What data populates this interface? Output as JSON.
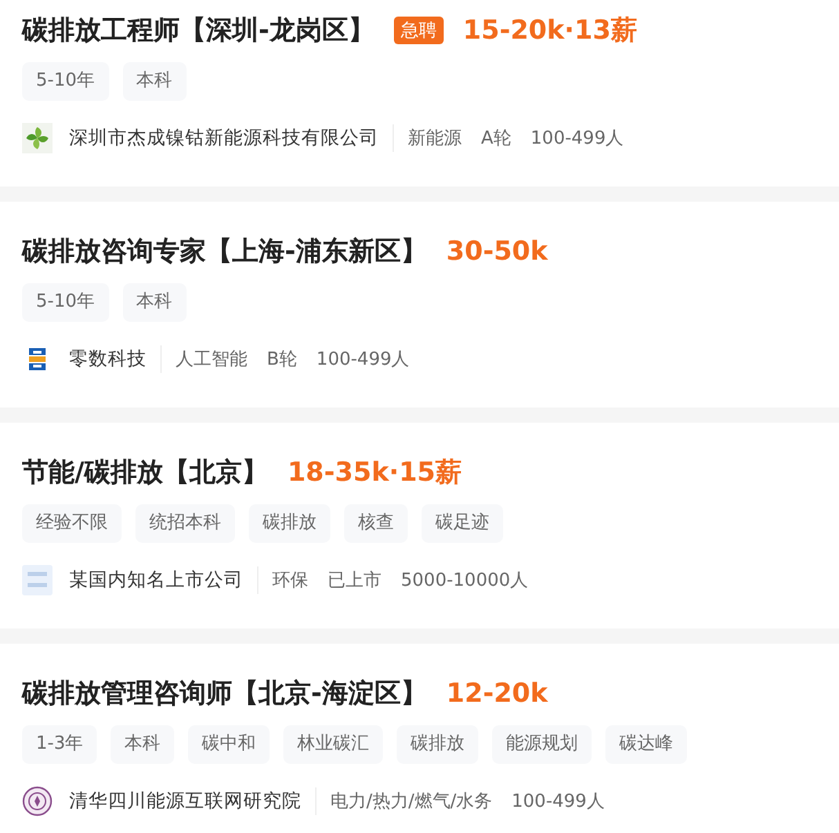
{
  "jobs": [
    {
      "title": "碳排放工程师【深圳-龙岗区】",
      "urgent_badge": "急聘",
      "salary": "15-20k·13薪",
      "tags": [
        "5-10年",
        "本科"
      ],
      "company": {
        "logo": {
          "kind": "leaf"
        },
        "name": "深圳市杰成镍钴新能源科技有限公司",
        "details": [
          "新能源",
          "A轮",
          "100-499人"
        ]
      }
    },
    {
      "title": "碳排放咨询专家【上海-浦东新区】",
      "salary": "30-50k",
      "tags": [
        "5-10年",
        "本科"
      ],
      "company": {
        "logo": {
          "kind": "blocks"
        },
        "name": "零数科技",
        "details": [
          "人工智能",
          "B轮",
          "100-499人"
        ]
      }
    },
    {
      "title": "节能/碳排放【北京】",
      "salary": "18-35k·15薪",
      "tags": [
        "经验不限",
        "统招本科",
        "碳排放",
        "核查",
        "碳足迹"
      ],
      "company": {
        "logo": {
          "kind": "placeholder"
        },
        "name": "某国内知名上市公司",
        "details": [
          "环保",
          "已上市",
          "5000-10000人"
        ]
      }
    },
    {
      "title": "碳排放管理咨询师【北京-海淀区】",
      "salary": "12-20k",
      "tags": [
        "1-3年",
        "本科",
        "碳中和",
        "林业碳汇",
        "碳排放",
        "能源规划",
        "碳达峰"
      ],
      "company": {
        "logo": {
          "kind": "seal"
        },
        "name": "清华四川能源互联网研究院",
        "details": [
          "电力/热力/燃气/水务",
          "100-499人"
        ]
      }
    }
  ]
}
